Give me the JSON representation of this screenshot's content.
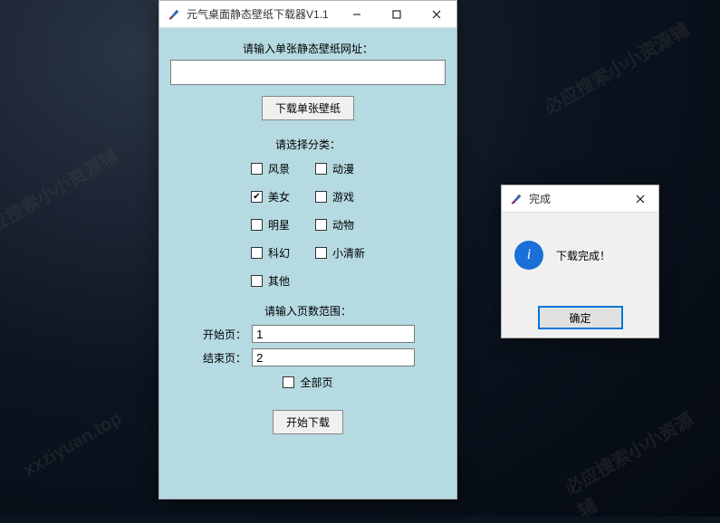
{
  "watermarks": [
    "必应搜索小小资源辅",
    "必应搜索小小资源辅",
    "xxziyuan.top",
    "必应搜索小小资源辅"
  ],
  "main": {
    "title": "元气桌面静态壁纸下载器V1.1",
    "url_label": "请输入单张静态壁纸网址：",
    "url_value": "",
    "download_single_btn": "下载单张壁纸",
    "category_label": "请选择分类：",
    "categories": [
      {
        "label": "风景",
        "checked": false
      },
      {
        "label": "动漫",
        "checked": false
      },
      {
        "label": "美女",
        "checked": true
      },
      {
        "label": "游戏",
        "checked": false
      },
      {
        "label": "明星",
        "checked": false
      },
      {
        "label": "动物",
        "checked": false
      },
      {
        "label": "科幻",
        "checked": false
      },
      {
        "label": "小清新",
        "checked": false
      },
      {
        "label": "其他",
        "checked": false
      }
    ],
    "page_range_label": "请输入页数范围：",
    "start_page_label": "开始页：",
    "start_page_value": "1",
    "end_page_label": "结束页：",
    "end_page_value": "2",
    "all_pages_label": "全部页",
    "all_pages_checked": false,
    "start_download_btn": "开始下载"
  },
  "dialog": {
    "title": "完成",
    "message": "下载完成！",
    "ok_btn": "确定"
  }
}
